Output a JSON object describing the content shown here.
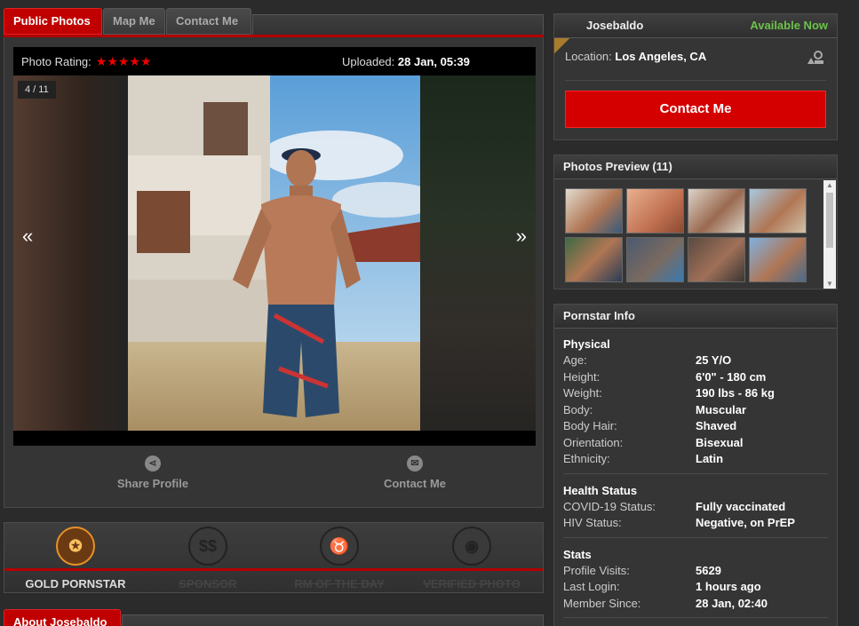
{
  "tabs": [
    "Public Photos",
    "Map Me",
    "Contact Me"
  ],
  "viewer": {
    "rating_label": "Photo Rating:",
    "stars": "★★★★★",
    "uploaded_label": "Uploaded:",
    "uploaded_value": "28 Jan, 05:39",
    "counter": "4 / 11",
    "prev": "«",
    "next": "»"
  },
  "actions": {
    "share": "Share Profile",
    "contact": "Contact Me"
  },
  "badges": [
    {
      "label": "GOLD PORNSTAR",
      "icon": "award-icon",
      "active": true
    },
    {
      "label": "SPONSOR",
      "icon": "dollar-icon",
      "active": false
    },
    {
      "label": "RM OF THE DAY",
      "icon": "devil-icon",
      "active": false
    },
    {
      "label": "VERIFIED PHOTO",
      "icon": "camera-icon",
      "active": false
    }
  ],
  "about_tab": "About Josebaldo",
  "profile": {
    "ribbon": "GOLD",
    "name": "Josebaldo",
    "status": "Available Now",
    "location_label": "Location:",
    "location_value": "Los Angeles, CA",
    "contact_button": "Contact Me"
  },
  "preview": {
    "title": "Photos Preview (11)"
  },
  "info": {
    "title": "Pornstar Info",
    "physical_title": "Physical",
    "physical": [
      {
        "k": "Age:",
        "v": "25 Y/O"
      },
      {
        "k": "Height:",
        "v": "6'0\" - 180 cm"
      },
      {
        "k": "Weight:",
        "v": "190 lbs - 86 kg"
      },
      {
        "k": "Body:",
        "v": "Muscular"
      },
      {
        "k": "Body Hair:",
        "v": "Shaved"
      },
      {
        "k": "Orientation:",
        "v": "Bisexual"
      },
      {
        "k": "Ethnicity:",
        "v": "Latin"
      }
    ],
    "health_title": "Health Status",
    "health": [
      {
        "k": "COVID-19 Status:",
        "v": "Fully vaccinated"
      },
      {
        "k": "HIV Status:",
        "v": "Negative, on PrEP"
      }
    ],
    "stats_title": "Stats",
    "stats": [
      {
        "k": "Profile Visits:",
        "v": "5629"
      },
      {
        "k": "Last Login:",
        "v": "1 hours ago"
      },
      {
        "k": "Member Since:",
        "v": "28 Jan, 02:40"
      }
    ]
  },
  "colors": {
    "accent_red": "#c00000",
    "available_green": "#6cc24a",
    "gold": "#e8902a"
  }
}
